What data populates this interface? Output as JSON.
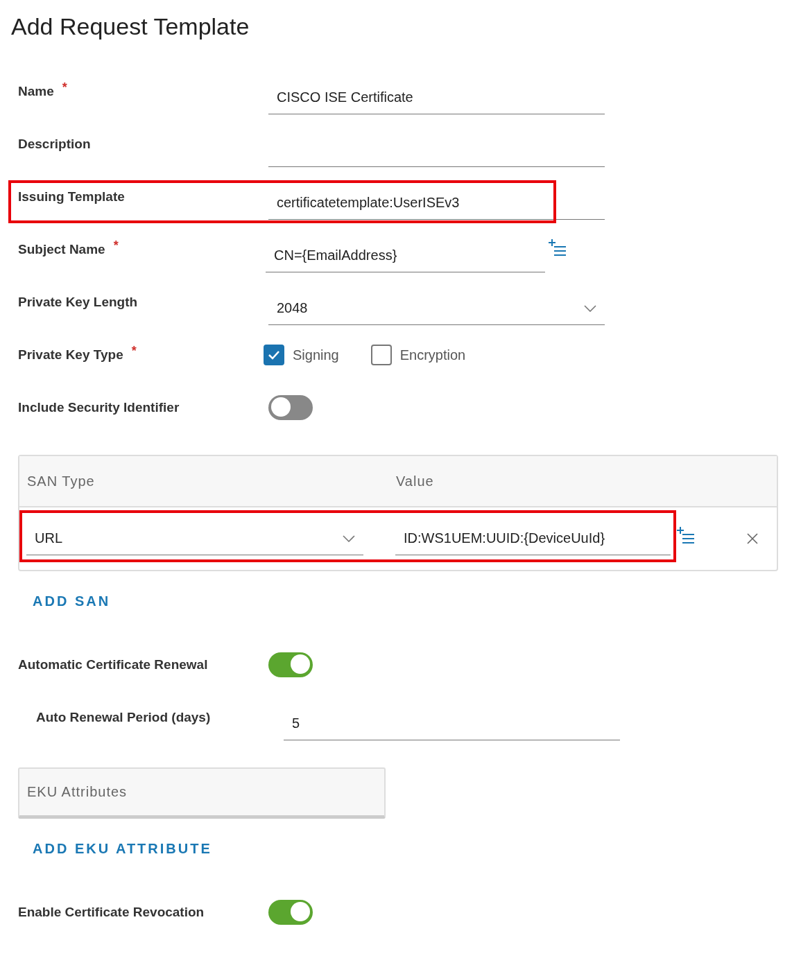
{
  "title": "Add Request Template",
  "sections": [
    {
      "kind": "input",
      "label": "Name",
      "required_mark": "*",
      "value": "CISCO ISE Certificate"
    },
    {
      "kind": "input",
      "label": "Description"
    },
    {
      "kind": "input",
      "label": "Issuing Template",
      "value": "certificatetemplate:UserISEv3",
      "highlighted": true
    },
    {
      "kind": "lookup",
      "label": "Subject Name",
      "required_mark": "*",
      "value": "CN={EmailAddress}"
    },
    {
      "kind": "select",
      "label": "Private Key Length",
      "value": "2048"
    },
    {
      "kind": "checks",
      "label": "Private Key Type",
      "required_mark": "*",
      "options": [
        {
          "label": "Signing",
          "checked": true
        },
        {
          "label": "Encryption",
          "checked": false
        }
      ]
    },
    {
      "kind": "toggle",
      "label": "Include Security Identifier",
      "on": false
    },
    {
      "kind": "san_table",
      "columns": [
        "SAN Type",
        "Value"
      ],
      "rows": [
        {
          "type": "URL",
          "value": "ID:WS1UEM:UUID:{DeviceUuId}",
          "highlighted": true
        }
      ]
    },
    {
      "kind": "link",
      "text": "ADD SAN"
    },
    {
      "kind": "toggle",
      "label": "Automatic Certificate Renewal",
      "on": true
    },
    {
      "kind": "subinput",
      "label": "Auto Renewal Period (days)",
      "value": "5"
    },
    {
      "kind": "panel",
      "title": "EKU Attributes"
    },
    {
      "kind": "link",
      "text": "ADD EKU ATTRIBUTE"
    },
    {
      "kind": "toggle",
      "label": "Enable Certificate Revocation",
      "on": true
    }
  ]
}
